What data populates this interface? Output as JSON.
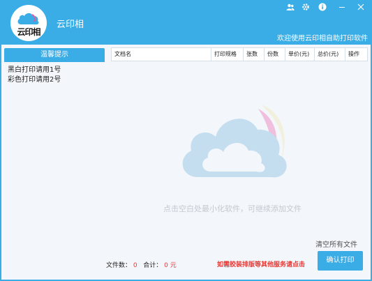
{
  "app": {
    "title": "云印相",
    "logo_text": "云印相",
    "welcome": "欢迎使用云印相自助打印软件"
  },
  "tips": {
    "header": "温馨提示",
    "lines": [
      "黑白打印请用1号",
      "彩色打印请用2号"
    ]
  },
  "table": {
    "columns": [
      "文档名",
      "打印规格",
      "张数",
      "份数",
      "单价(元)",
      "总价(元)",
      "操作"
    ]
  },
  "main": {
    "hint": "点击空白处最小化软件，可继续添加文件",
    "clear_all": "清空所有文件"
  },
  "footer": {
    "file_count_label": "文件数：",
    "file_count": "0",
    "total_label": "合计：",
    "total_value": "0",
    "currency": "元",
    "service_link": "如需胶装排版等其他服务请点击",
    "confirm_button": "确认打印"
  },
  "icons": {
    "user": "user-icon",
    "gear": "gear-icon",
    "info": "info-icon",
    "minimize": "minimize-icon",
    "close": "close-icon"
  },
  "colors": {
    "accent": "#3aace6",
    "highlight": "#e53935"
  }
}
